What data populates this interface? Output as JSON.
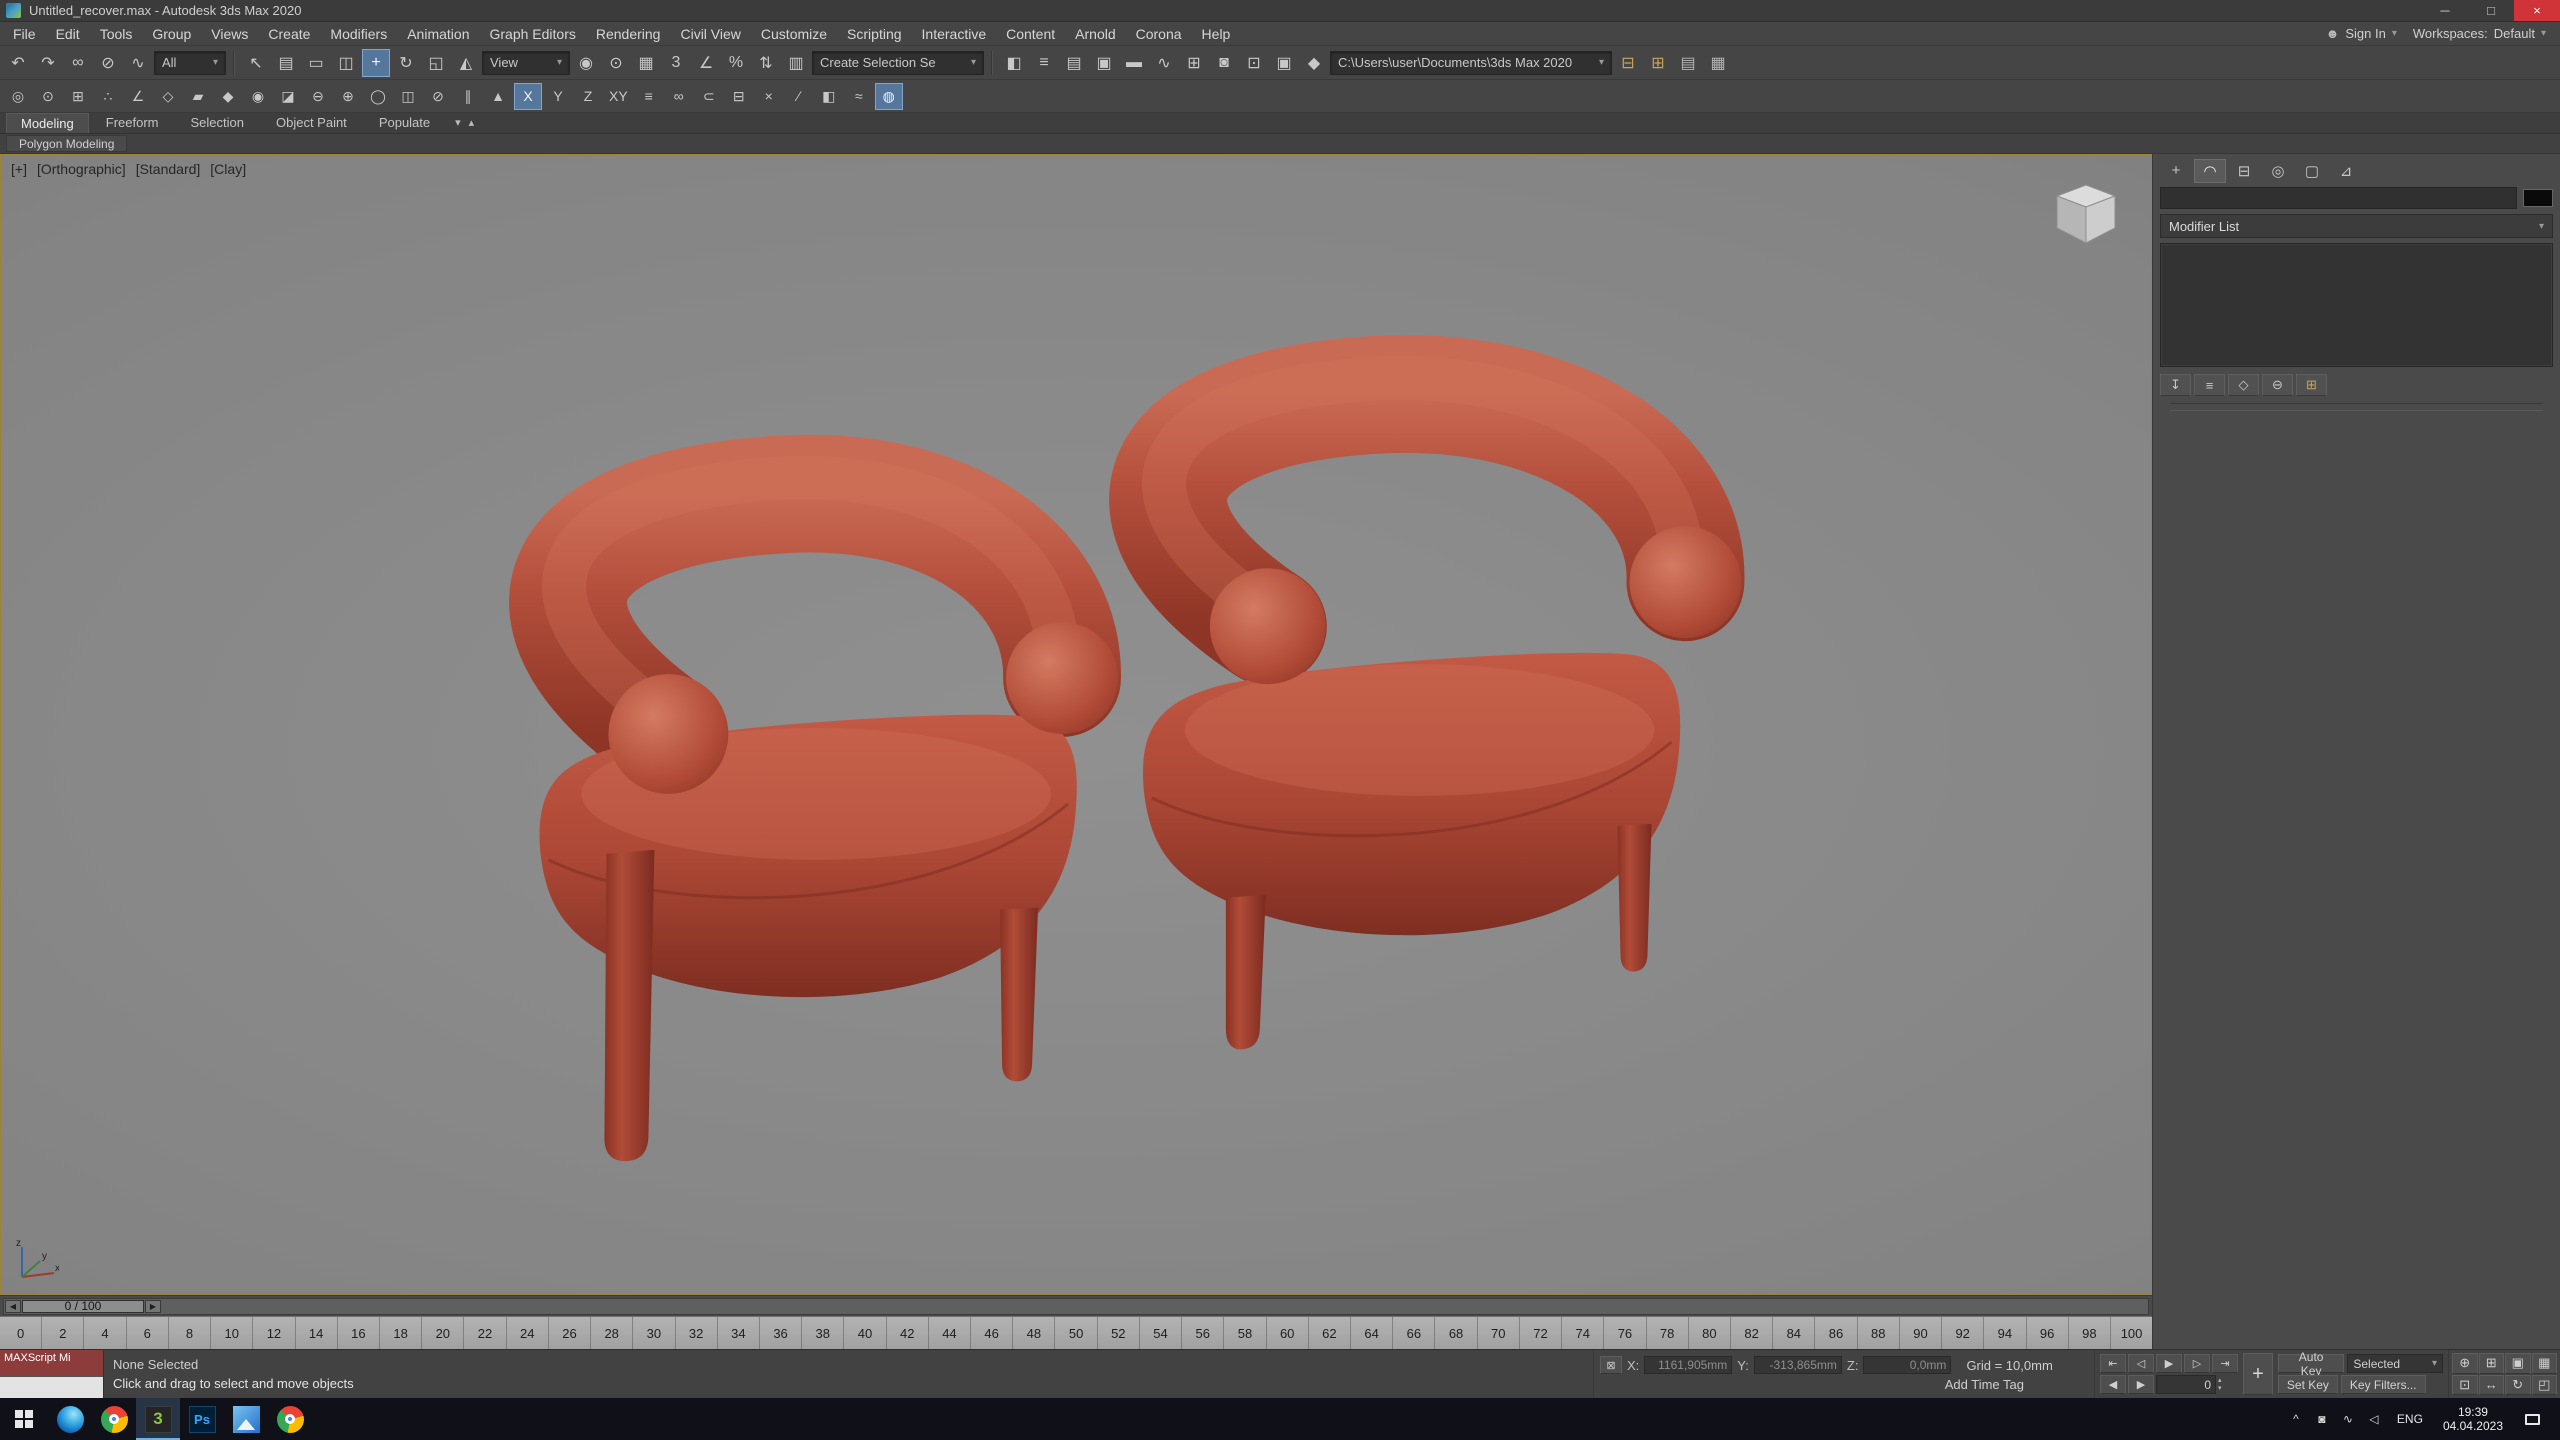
{
  "window": {
    "title": "Untitled_recover.max - Autodesk 3ds Max 2020",
    "minimize": "─",
    "maximize": "□",
    "close": "×"
  },
  "account": {
    "sign_in": "Sign In",
    "workspaces_label": "Workspaces:",
    "workspace_value": "Default",
    "person_icon": "☻"
  },
  "ui": {
    "caret": "▾",
    "spin_up": "▴",
    "spin_down": "▾",
    "prev": "◀",
    "next": "▶"
  },
  "menubar": {
    "items": [
      {
        "name": "menu-file",
        "label": "File"
      },
      {
        "name": "menu-edit",
        "label": "Edit"
      },
      {
        "name": "menu-tools",
        "label": "Tools"
      },
      {
        "name": "menu-group",
        "label": "Group"
      },
      {
        "name": "menu-views",
        "label": "Views"
      },
      {
        "name": "menu-create",
        "label": "Create"
      },
      {
        "name": "menu-modifiers",
        "label": "Modifiers"
      },
      {
        "name": "menu-animation",
        "label": "Animation"
      },
      {
        "name": "menu-graph-editors",
        "label": "Graph Editors"
      },
      {
        "name": "menu-rendering",
        "label": "Rendering"
      },
      {
        "name": "menu-civil-view",
        "label": "Civil View"
      },
      {
        "name": "menu-customize",
        "label": "Customize"
      },
      {
        "name": "menu-scripting",
        "label": "Scripting"
      },
      {
        "name": "menu-interactive",
        "label": "Interactive"
      },
      {
        "name": "menu-content",
        "label": "Content"
      },
      {
        "name": "menu-arnold",
        "label": "Arnold"
      },
      {
        "name": "menu-corona",
        "label": "Corona"
      },
      {
        "name": "menu-help",
        "label": "Help"
      }
    ]
  },
  "toolbar1": {
    "left_icons": [
      {
        "name": "undo-icon",
        "glyph": "↶"
      },
      {
        "name": "redo-icon",
        "glyph": "↷"
      },
      {
        "name": "select-and-link-icon",
        "glyph": "∞"
      },
      {
        "name": "unlink-selection-icon",
        "glyph": "⊘"
      },
      {
        "name": "bind-to-space-warp-icon",
        "glyph": "∿"
      }
    ],
    "filter_label": "All",
    "select_icons": [
      {
        "name": "select-object-icon",
        "glyph": "↖"
      },
      {
        "name": "select-by-name-icon",
        "glyph": "▤"
      },
      {
        "name": "selection-region-icon",
        "glyph": "▭"
      },
      {
        "name": "window-crossing-icon",
        "glyph": "◫"
      },
      {
        "name": "select-and-move-icon",
        "glyph": "+",
        "active": true
      },
      {
        "name": "select-and-rotate-icon",
        "glyph": "↻"
      },
      {
        "name": "select-and-scale-icon",
        "glyph": "◱"
      },
      {
        "name": "select-and-place-icon",
        "glyph": "◭"
      }
    ],
    "coord_label": "View",
    "mid_icons": [
      {
        "name": "use-center-icon",
        "glyph": "◉"
      },
      {
        "name": "select-and-manipulate-icon",
        "glyph": "⊙"
      },
      {
        "name": "keyboard-override-icon",
        "glyph": "▦"
      },
      {
        "name": "snaps-toggle-icon",
        "glyph": "3"
      },
      {
        "name": "angle-snap-icon",
        "glyph": "∠"
      },
      {
        "name": "percent-snap-icon",
        "glyph": "%"
      },
      {
        "name": "spinner-snap-icon",
        "glyph": "⇅"
      },
      {
        "name": "edit-named-selection-sets-icon",
        "glyph": "▥"
      }
    ],
    "selection_set_label": "Create Selection Se",
    "right_icons": [
      {
        "name": "mirror-icon",
        "glyph": "◧"
      },
      {
        "name": "align-icon",
        "glyph": "≡"
      },
      {
        "name": "scene-explorer-icon",
        "glyph": "▤"
      },
      {
        "name": "layer-explorer-icon",
        "glyph": "▣"
      },
      {
        "name": "ribbon-toggle-icon",
        "glyph": "▬"
      },
      {
        "name": "curve-editor-icon",
        "glyph": "∿"
      },
      {
        "name": "schematic-view-icon",
        "glyph": "⊞"
      },
      {
        "name": "material-editor-icon",
        "glyph": "◙"
      },
      {
        "name": "render-setup-icon",
        "glyph": "⊡"
      },
      {
        "name": "rendered-frame-icon",
        "glyph": "▣"
      },
      {
        "name": "render-production-icon",
        "glyph": "◆"
      }
    ],
    "path_label": "C:\\Users\\user\\Documents\\3ds Max 2020",
    "folder_icons": [
      {
        "name": "project-folder-icon",
        "glyph": "⊟",
        "color": "#c9a558"
      },
      {
        "name": "open-folder-icon",
        "glyph": "⊞",
        "color": "#c9a558"
      },
      {
        "name": "asset-tracking-icon",
        "glyph": "▤",
        "color": "#b5b5b5"
      },
      {
        "name": "file-reference-icon",
        "glyph": "▦",
        "color": "#b5b5b5"
      }
    ]
  },
  "toolbar2": {
    "items": [
      {
        "name": "pivot-point-icon",
        "glyph": "◎"
      },
      {
        "name": "use-selection-center-icon",
        "glyph": "⊙"
      },
      {
        "name": "transform-gizmo-icon",
        "glyph": "⊞"
      },
      {
        "name": "vertex-mode-icon",
        "glyph": "∴"
      },
      {
        "name": "edge-mode-icon",
        "glyph": "∠"
      },
      {
        "name": "border-mode-icon",
        "glyph": "◇"
      },
      {
        "name": "polygon-mode-icon",
        "glyph": "▰"
      },
      {
        "name": "element-mode-icon",
        "glyph": "◆"
      },
      {
        "name": "soft-selection-icon",
        "glyph": "◉"
      },
      {
        "name": "ignore-backfacing-icon",
        "glyph": "◪"
      },
      {
        "name": "shrink-selection-icon",
        "glyph": "⊖"
      },
      {
        "name": "grow-selection-icon",
        "glyph": "⊕"
      },
      {
        "name": "loop-selection-icon",
        "glyph": "◯"
      },
      {
        "name": "ring-selection-icon",
        "glyph": "◫"
      },
      {
        "name": "constraint-none-icon",
        "glyph": "⊘"
      },
      {
        "name": "constraint-edge-icon",
        "glyph": "∥"
      },
      {
        "name": "constraint-face-icon",
        "glyph": "▲"
      },
      {
        "name": "x-axis-constraint-button",
        "glyph": "X",
        "active": true
      },
      {
        "name": "y-axis-constraint-button",
        "glyph": "Y"
      },
      {
        "name": "z-axis-constraint-button",
        "glyph": "Z"
      },
      {
        "name": "xy-plane-constraint-button",
        "glyph": "XY"
      },
      {
        "name": "collapse-icon",
        "glyph": "≡"
      },
      {
        "name": "attach-icon",
        "glyph": "∞"
      },
      {
        "name": "detach-icon",
        "glyph": "⊂"
      },
      {
        "name": "slice-plane-icon",
        "glyph": "⊟"
      },
      {
        "name": "cut-icon",
        "glyph": "×"
      },
      {
        "name": "quick-slice-icon",
        "glyph": "∕"
      },
      {
        "name": "swift-loop-icon",
        "glyph": "◧"
      },
      {
        "name": "paint-connect-icon",
        "glyph": "≈"
      },
      {
        "name": "turbosmooth-toggle-icon",
        "glyph": "◍",
        "active": true
      }
    ]
  },
  "ribbon": {
    "tabs": [
      {
        "name": "ribbon-tab-modeling",
        "label": "Modeling",
        "active": true
      },
      {
        "name": "ribbon-tab-freeform",
        "label": "Freeform"
      },
      {
        "name": "ribbon-tab-selection",
        "label": "Selection"
      },
      {
        "name": "ribbon-tab-object-paint",
        "label": "Object Paint"
      },
      {
        "name": "ribbon-tab-populate",
        "label": "Populate"
      }
    ],
    "menu_icon": "▾",
    "collapse_icon": "▴",
    "panel_label": "Polygon Modeling"
  },
  "viewport": {
    "labels": [
      {
        "name": "viewport-general-menu",
        "text": "[+]"
      },
      {
        "name": "viewport-pov-menu",
        "text": "[Orthographic]"
      },
      {
        "name": "viewport-standard-menu",
        "text": "[Standard]"
      },
      {
        "name": "viewport-shading-menu",
        "text": "[Clay]"
      }
    ],
    "axis": {
      "x": "x",
      "y": "y",
      "z": "z"
    }
  },
  "command_panel": {
    "tabs": [
      {
        "name": "tab-create",
        "glyph": "+"
      },
      {
        "name": "tab-modify",
        "glyph": "◠",
        "active": true
      },
      {
        "name": "tab-hierarchy",
        "glyph": "⊟"
      },
      {
        "name": "tab-motion",
        "glyph": "◎"
      },
      {
        "name": "tab-display",
        "glyph": "▢"
      },
      {
        "name": "tab-utilities",
        "glyph": "⊿"
      }
    ],
    "modifier_list_label": "Modifier List",
    "stack_buttons": [
      {
        "name": "pin-stack-icon",
        "glyph": "↧"
      },
      {
        "name": "show-end-result-icon",
        "glyph": "≡"
      },
      {
        "name": "make-unique-icon",
        "glyph": "◇"
      },
      {
        "name": "remove-modifier-icon",
        "glyph": "⊖"
      },
      {
        "name": "configure-modifier-sets-icon",
        "glyph": "⊞",
        "color": "#c9a558"
      }
    ]
  },
  "timeline": {
    "slider_label": "0 / 100",
    "start": 0,
    "end": 100,
    "step": 2
  },
  "status": {
    "maxscript_label": "MAXScript Mi",
    "selected_line": "None Selected",
    "prompt_line": "Click and drag to select and move objects",
    "lock_icon": "⊠",
    "x_label": "X:",
    "x_value": "1161,905mm",
    "y_label": "Y:",
    "y_value": "-313,865mm",
    "z_label": "Z:",
    "z_value": "0,0mm",
    "grid_label": "Grid = 10,0mm",
    "add_time_tag": "Add Time Tag",
    "frame_value": "0",
    "set_keys_icon": "+",
    "auto_key": "Auto Key",
    "selected_dropdown": "Selected",
    "set_key": "Set Key",
    "key_filters": "Key Filters..."
  },
  "playback": {
    "buttons": [
      {
        "name": "go-to-start-icon",
        "glyph": "⇤"
      },
      {
        "name": "previous-frame-icon",
        "glyph": "◁"
      },
      {
        "name": "play-icon",
        "glyph": "▶"
      },
      {
        "name": "next-frame-icon",
        "glyph": "▷"
      },
      {
        "name": "go-to-end-icon",
        "glyph": "⇥"
      }
    ]
  },
  "nav": {
    "buttons": [
      {
        "name": "zoom-icon",
        "glyph": "⊕"
      },
      {
        "name": "zoom-all-icon",
        "glyph": "⊞"
      },
      {
        "name": "zoom-extents-icon",
        "glyph": "▣"
      },
      {
        "name": "zoom-extents-all-icon",
        "glyph": "▦"
      },
      {
        "name": "zoom-region-icon",
        "glyph": "⊡"
      },
      {
        "name": "pan-icon",
        "glyph": "↔"
      },
      {
        "name": "orbit-icon",
        "glyph": "↻"
      },
      {
        "name": "maximize-viewport-icon",
        "glyph": "◰"
      }
    ]
  },
  "taskbar": {
    "max_label": "3",
    "ps_label": "Ps",
    "tray": [
      {
        "name": "tray-expand-icon",
        "glyph": "^"
      },
      {
        "name": "tray-security-icon",
        "glyph": "◙"
      },
      {
        "name": "tray-network-icon",
        "glyph": "∿"
      },
      {
        "name": "tray-volume-icon",
        "glyph": "◁"
      }
    ],
    "lang": "ENG",
    "time": "19:39",
    "date": "04.04.2023"
  },
  "colors": {
    "chair_red": "#b04a38",
    "active_tool": "#55779c",
    "viewport_border": "#9c8338",
    "taskbar_bg": "#101018"
  }
}
